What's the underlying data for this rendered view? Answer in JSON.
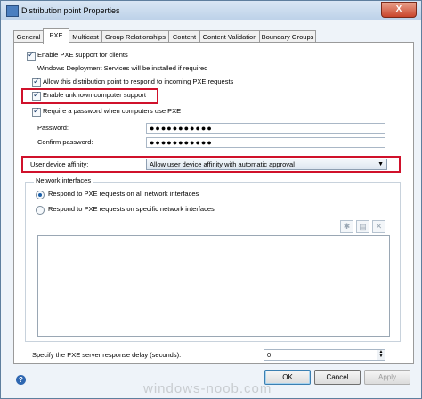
{
  "window": {
    "title": "Distribution point Properties",
    "close_glyph": "X"
  },
  "tabs": [
    "General",
    "PXE",
    "Multicast",
    "Group Relationships",
    "Content",
    "Content Validation",
    "Boundary Groups"
  ],
  "active_tab": "PXE",
  "pxe": {
    "enable_pxe": {
      "label": "Enable PXE support for clients",
      "checked": true
    },
    "wds_note": "Windows Deployment Services will be installed if required",
    "allow_respond": {
      "label": "Allow this distribution point to respond to incoming PXE requests",
      "checked": true
    },
    "enable_unknown": {
      "label": "Enable unknown computer support",
      "checked": true
    },
    "require_password": {
      "label": "Require a password when computers use PXE",
      "checked": true
    },
    "password_label": "Password:",
    "password_value": "●●●●●●●●●●●",
    "confirm_label": "Confirm password:",
    "confirm_value": "●●●●●●●●●●●",
    "affinity_label": "User device affinity:",
    "affinity_value": "Allow user device affinity with automatic approval",
    "network_group_label": "Network interfaces",
    "radio_all": {
      "label": "Respond to PXE requests on all network interfaces",
      "checked": true
    },
    "radio_specific": {
      "label": "Respond to PXE requests on specific network interfaces",
      "checked": false
    },
    "delay_label": "Specify the PXE server response delay (seconds):",
    "delay_value": "0"
  },
  "toolbar_icons": [
    "star-icon",
    "list-icon",
    "delete-icon"
  ],
  "buttons": {
    "ok": "OK",
    "cancel": "Cancel",
    "apply": "Apply"
  },
  "help_glyph": "?",
  "watermark": "windows-noob.com",
  "colors": {
    "highlight_box": "#d0112b",
    "title_bar": "#bcd1e8"
  }
}
